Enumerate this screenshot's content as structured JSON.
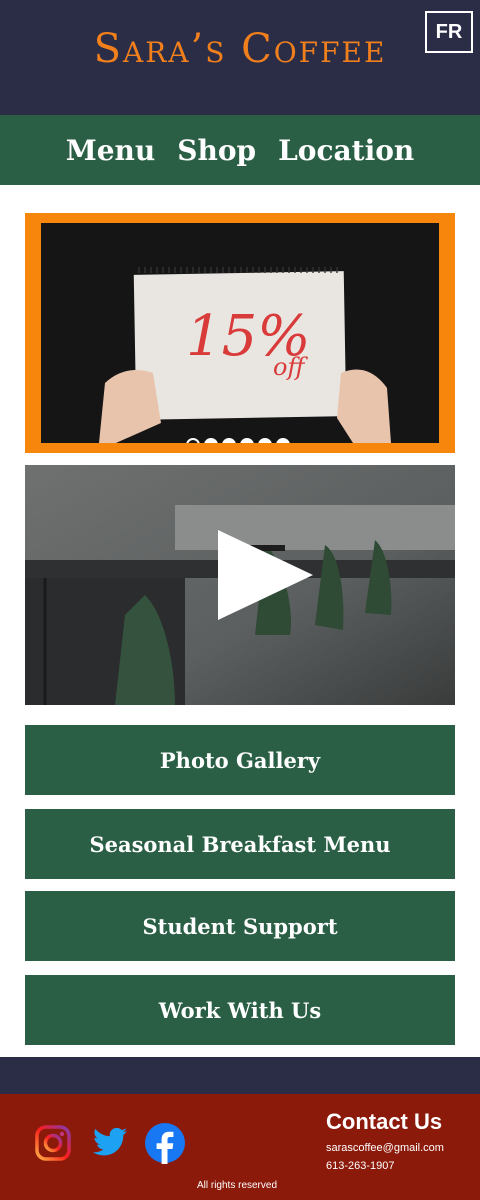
{
  "header": {
    "logo": "Sara’s Coffee",
    "lang_toggle": "FR"
  },
  "nav": {
    "items": [
      "Menu",
      "Shop",
      "Location"
    ]
  },
  "carousel": {
    "sign_text": "15%",
    "sign_sub": "off",
    "slide_count": 6,
    "active_index": 0
  },
  "video": {
    "icon": "play-icon"
  },
  "buttons": [
    "Photo Gallery",
    "Seasonal Breakfast Menu",
    "Student Support",
    "Work With Us"
  ],
  "footer": {
    "social": [
      "instagram-icon",
      "twitter-icon",
      "facebook-icon"
    ],
    "contact_title": "Contact Us",
    "email": "sarascoffee@gmail.com",
    "phone": "613-263-1907",
    "rights": "All rights reserved"
  },
  "colors": {
    "header_bg": "#2b2d47",
    "green": "#2a5f45",
    "orange": "#f7860d",
    "logo": "#f07f1c",
    "footer_bg": "#8b1a0a"
  }
}
